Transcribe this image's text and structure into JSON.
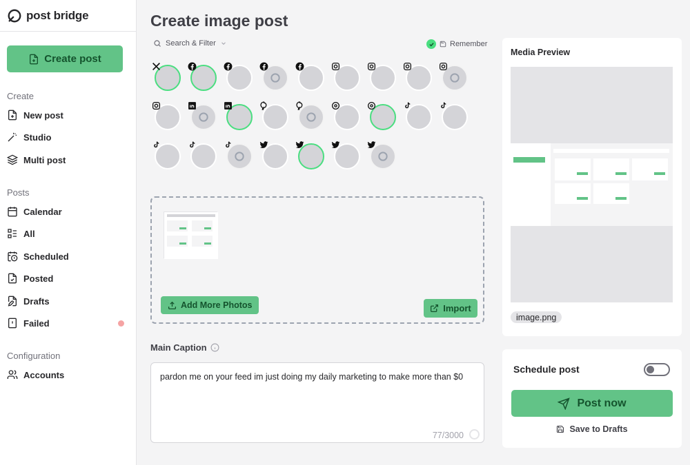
{
  "brand": {
    "name": "post bridge"
  },
  "sidebar": {
    "create_button": "Create post",
    "sections": [
      {
        "title": "Create",
        "items": [
          "New post",
          "Studio",
          "Multi post"
        ]
      },
      {
        "title": "Posts",
        "items": [
          "Calendar",
          "All",
          "Scheduled",
          "Posted",
          "Drafts",
          "Failed"
        ]
      },
      {
        "title": "Configuration",
        "items": [
          "Accounts"
        ]
      }
    ]
  },
  "main": {
    "title": "Create image post",
    "search_placeholder": "Search & Filter",
    "remember_label": "Remember",
    "accounts": [
      {
        "platform": "x",
        "selected": true,
        "avatar": "face"
      },
      {
        "platform": "facebook",
        "selected": true,
        "avatar": "face"
      },
      {
        "platform": "facebook",
        "selected": false,
        "avatar": "gray"
      },
      {
        "platform": "facebook",
        "selected": false,
        "avatar": "empty"
      },
      {
        "platform": "facebook",
        "selected": false,
        "avatar": "line"
      },
      {
        "platform": "instagram",
        "selected": false,
        "avatar": "gray"
      },
      {
        "platform": "instagram",
        "selected": false,
        "avatar": "gray"
      },
      {
        "platform": "instagram",
        "selected": false,
        "avatar": "gray"
      },
      {
        "platform": "instagram",
        "selected": false,
        "avatar": "empty"
      },
      {
        "platform": "instagram",
        "selected": false,
        "avatar": "line"
      },
      {
        "platform": "linkedin",
        "selected": false,
        "avatar": "empty"
      },
      {
        "platform": "linkedin",
        "selected": true,
        "avatar": "face"
      },
      {
        "platform": "pinterest",
        "selected": false,
        "avatar": "gray"
      },
      {
        "platform": "pinterest",
        "selected": false,
        "avatar": "empty"
      },
      {
        "platform": "threads",
        "selected": false,
        "avatar": "gray"
      },
      {
        "platform": "threads",
        "selected": true,
        "avatar": "face"
      },
      {
        "platform": "tiktok",
        "selected": false,
        "avatar": "gray"
      },
      {
        "platform": "tiktok",
        "selected": false,
        "avatar": "gray"
      },
      {
        "platform": "tiktok",
        "selected": false,
        "avatar": "gray"
      },
      {
        "platform": "tiktok",
        "selected": false,
        "avatar": "line"
      },
      {
        "platform": "tiktok",
        "selected": false,
        "avatar": "empty"
      },
      {
        "platform": "twitter",
        "selected": false,
        "avatar": "line"
      },
      {
        "platform": "twitter",
        "selected": true,
        "avatar": "face"
      },
      {
        "platform": "twitter",
        "selected": false,
        "avatar": "gray"
      },
      {
        "platform": "twitter",
        "selected": false,
        "avatar": "empty"
      }
    ],
    "add_photos_label": "Add More Photos",
    "import_label": "Import",
    "caption_label": "Main Caption",
    "caption_text": "pardon me on your feed im just doing my daily marketing to make more than $0",
    "caption_counter": "77/3000"
  },
  "media_preview": {
    "title": "Media Preview",
    "file_name": "image.png"
  },
  "schedule": {
    "label": "Schedule post",
    "post_now": "Post now",
    "save_drafts": "Save to Drafts"
  },
  "colors": {
    "accent": "#62c387",
    "accent_text": "#14532d",
    "failed_dot": "#f5a3a3"
  }
}
